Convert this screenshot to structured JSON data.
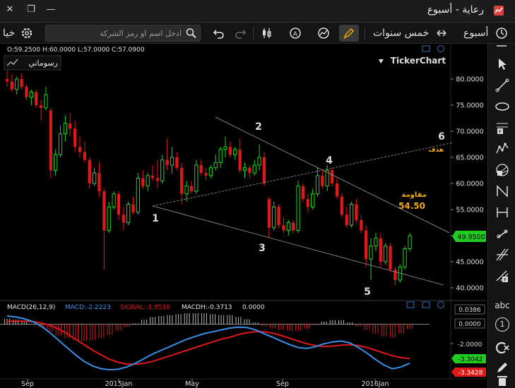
{
  "window": {
    "title": "رعاية - أسبوع",
    "close_glyph": "✕",
    "restore_glyph": "❐",
    "minimize_glyph": "—"
  },
  "toolbar": {
    "period_label": "أسبوع",
    "range_label": "خمس سنوات",
    "search_placeholder": "ادخل اسم او رمز الشركة",
    "options_label": "خيا"
  },
  "price_info": "O:59.2500  H:60.0000  L:57.0000  C:57.0900",
  "drawings_label": "رسوماتي",
  "brand": "TickerChart",
  "annotations": {
    "wave_labels": [
      "1",
      "2",
      "3",
      "4",
      "5",
      "6"
    ],
    "target_label": "هدف",
    "resistance_label": "مقاومة",
    "resistance_value": "54.50"
  },
  "macd_legend": {
    "name": "MACD(26,12,9)",
    "macd": "MACD:-2.2223",
    "signal": "SIGNAL:-1.8510",
    "macdh": "MACDH:-0.3713",
    "zero": "0.0000"
  },
  "sidebar_tools": [
    "cursor-icon",
    "trendline-icon",
    "ellipse-icon",
    "fibonacci-icon",
    "elliott-wave-icon",
    "fibonacci-fan-icon",
    "zigzag-icon",
    "hline-icon",
    "ray-icon",
    "andrews-pitchfork-icon",
    "fibonacci-retracement-icon",
    "text-tool-icon",
    "numbered-tool-icon",
    "delete-drawings-icon",
    "pencil-icon",
    "trash-icon"
  ],
  "sidebar_text": {
    "abc": "abc",
    "one": "1"
  },
  "colors": {
    "up": "#1fd31f",
    "down": "#e01818",
    "macd": "#3a8ee6",
    "signal": "#e01818",
    "accent": "#f2a900",
    "current_price_bg": "#1fcc1f"
  },
  "chart_data": {
    "type": "candlestick",
    "x_tick_labels": [
      "Sep",
      "2015Jan",
      "May",
      "Sep",
      "2016Jan"
    ],
    "y_tick_labels": [
      "40.0000",
      "45.0000",
      "50.0000",
      "55.0000",
      "60.0000",
      "65.0000",
      "70.0000",
      "75.0000",
      "80.0000"
    ],
    "ylim": [
      38.0,
      82.0
    ],
    "current_price_label": "49.9500",
    "candles": [
      {
        "o": 80.0,
        "h": 81.5,
        "l": 78.5,
        "c": 79.5
      },
      {
        "o": 79.5,
        "h": 81.0,
        "l": 77.5,
        "c": 78.0
      },
      {
        "o": 78.0,
        "h": 80.5,
        "l": 77.0,
        "c": 80.0
      },
      {
        "o": 80.0,
        "h": 81.0,
        "l": 78.0,
        "c": 78.5
      },
      {
        "o": 78.5,
        "h": 79.0,
        "l": 76.0,
        "c": 76.5
      },
      {
        "o": 76.5,
        "h": 78.0,
        "l": 75.0,
        "c": 77.5
      },
      {
        "o": 77.5,
        "h": 78.0,
        "l": 74.5,
        "c": 75.0
      },
      {
        "o": 75.0,
        "h": 76.0,
        "l": 72.0,
        "c": 74.5
      },
      {
        "o": 74.5,
        "h": 78.5,
        "l": 74.0,
        "c": 77.0
      },
      {
        "o": 74.0,
        "h": 74.5,
        "l": 61.0,
        "c": 62.5
      },
      {
        "o": 62.5,
        "h": 66.5,
        "l": 61.5,
        "c": 65.5
      },
      {
        "o": 65.5,
        "h": 71.0,
        "l": 65.0,
        "c": 69.5
      },
      {
        "o": 69.5,
        "h": 73.0,
        "l": 68.0,
        "c": 71.5
      },
      {
        "o": 71.5,
        "h": 73.5,
        "l": 69.0,
        "c": 70.5
      },
      {
        "o": 70.5,
        "h": 72.0,
        "l": 66.0,
        "c": 67.0
      },
      {
        "o": 67.0,
        "h": 69.0,
        "l": 65.0,
        "c": 66.0
      },
      {
        "o": 66.0,
        "h": 68.0,
        "l": 64.0,
        "c": 64.5
      },
      {
        "o": 64.5,
        "h": 65.0,
        "l": 59.0,
        "c": 60.0
      },
      {
        "o": 60.0,
        "h": 63.0,
        "l": 59.5,
        "c": 62.0
      },
      {
        "o": 62.0,
        "h": 64.0,
        "l": 57.5,
        "c": 58.5
      },
      {
        "o": 58.5,
        "h": 59.0,
        "l": 43.5,
        "c": 51.0
      },
      {
        "o": 51.0,
        "h": 56.5,
        "l": 50.5,
        "c": 55.5
      },
      {
        "o": 55.5,
        "h": 58.5,
        "l": 55.0,
        "c": 58.0
      },
      {
        "o": 58.0,
        "h": 58.5,
        "l": 53.0,
        "c": 54.0
      },
      {
        "o": 54.0,
        "h": 55.5,
        "l": 51.0,
        "c": 52.5
      },
      {
        "o": 52.5,
        "h": 56.5,
        "l": 52.0,
        "c": 56.0
      },
      {
        "o": 56.0,
        "h": 57.5,
        "l": 54.0,
        "c": 54.5
      },
      {
        "o": 54.5,
        "h": 62.0,
        "l": 54.0,
        "c": 61.0
      },
      {
        "o": 61.0,
        "h": 62.5,
        "l": 59.0,
        "c": 59.5
      },
      {
        "o": 59.5,
        "h": 62.0,
        "l": 58.5,
        "c": 61.5
      },
      {
        "o": 61.5,
        "h": 63.5,
        "l": 60.5,
        "c": 61.0
      },
      {
        "o": 61.0,
        "h": 64.5,
        "l": 59.0,
        "c": 60.5
      },
      {
        "o": 60.5,
        "h": 65.5,
        "l": 60.0,
        "c": 64.5
      },
      {
        "o": 64.5,
        "h": 68.5,
        "l": 62.5,
        "c": 63.5
      },
      {
        "o": 63.5,
        "h": 67.0,
        "l": 62.0,
        "c": 65.0
      },
      {
        "o": 65.0,
        "h": 66.0,
        "l": 62.5,
        "c": 63.0
      },
      {
        "o": 63.0,
        "h": 64.0,
        "l": 56.0,
        "c": 58.0
      },
      {
        "o": 58.0,
        "h": 60.5,
        "l": 56.5,
        "c": 59.5
      },
      {
        "o": 59.5,
        "h": 60.5,
        "l": 58.0,
        "c": 58.5
      },
      {
        "o": 58.5,
        "h": 64.5,
        "l": 58.0,
        "c": 63.5
      },
      {
        "o": 63.5,
        "h": 64.5,
        "l": 61.5,
        "c": 62.0
      },
      {
        "o": 62.0,
        "h": 63.0,
        "l": 60.5,
        "c": 61.5
      },
      {
        "o": 61.5,
        "h": 63.5,
        "l": 61.0,
        "c": 63.0
      },
      {
        "o": 63.0,
        "h": 65.5,
        "l": 62.5,
        "c": 64.0
      },
      {
        "o": 64.0,
        "h": 67.0,
        "l": 63.0,
        "c": 66.5
      },
      {
        "o": 66.5,
        "h": 69.0,
        "l": 65.0,
        "c": 67.0
      },
      {
        "o": 67.0,
        "h": 68.0,
        "l": 65.0,
        "c": 65.5
      },
      {
        "o": 65.5,
        "h": 67.0,
        "l": 64.5,
        "c": 66.5
      },
      {
        "o": 66.5,
        "h": 68.5,
        "l": 62.0,
        "c": 62.5
      },
      {
        "o": 62.5,
        "h": 64.0,
        "l": 61.0,
        "c": 63.0
      },
      {
        "o": 63.0,
        "h": 63.5,
        "l": 61.0,
        "c": 62.0
      },
      {
        "o": 62.0,
        "h": 64.5,
        "l": 61.5,
        "c": 63.5
      },
      {
        "o": 63.5,
        "h": 67.5,
        "l": 62.5,
        "c": 65.0
      },
      {
        "o": 65.0,
        "h": 66.0,
        "l": 59.5,
        "c": 60.0
      },
      {
        "o": 57.0,
        "h": 57.5,
        "l": 49.5,
        "c": 51.5
      },
      {
        "o": 51.5,
        "h": 56.5,
        "l": 51.0,
        "c": 55.5
      },
      {
        "o": 55.5,
        "h": 56.0,
        "l": 51.5,
        "c": 52.0
      },
      {
        "o": 52.0,
        "h": 53.5,
        "l": 50.5,
        "c": 51.0
      },
      {
        "o": 51.0,
        "h": 53.0,
        "l": 50.0,
        "c": 52.5
      },
      {
        "o": 52.5,
        "h": 53.0,
        "l": 50.5,
        "c": 51.0
      },
      {
        "o": 51.0,
        "h": 60.5,
        "l": 50.5,
        "c": 59.5
      },
      {
        "o": 59.5,
        "h": 60.0,
        "l": 56.5,
        "c": 57.0
      },
      {
        "o": 57.0,
        "h": 58.0,
        "l": 54.5,
        "c": 55.5
      },
      {
        "o": 55.5,
        "h": 59.0,
        "l": 55.0,
        "c": 58.0
      },
      {
        "o": 58.0,
        "h": 63.0,
        "l": 57.5,
        "c": 61.5
      },
      {
        "o": 61.5,
        "h": 62.5,
        "l": 59.0,
        "c": 59.5
      },
      {
        "o": 59.5,
        "h": 63.5,
        "l": 58.5,
        "c": 62.5
      },
      {
        "o": 62.5,
        "h": 63.0,
        "l": 59.5,
        "c": 60.0
      },
      {
        "o": 60.0,
        "h": 61.0,
        "l": 57.0,
        "c": 57.5
      },
      {
        "o": 57.5,
        "h": 58.0,
        "l": 53.5,
        "c": 54.0
      },
      {
        "o": 54.0,
        "h": 55.5,
        "l": 51.5,
        "c": 52.0
      },
      {
        "o": 52.0,
        "h": 56.5,
        "l": 51.5,
        "c": 56.0
      },
      {
        "o": 56.0,
        "h": 57.0,
        "l": 52.5,
        "c": 53.0
      },
      {
        "o": 53.0,
        "h": 54.0,
        "l": 50.5,
        "c": 51.0
      },
      {
        "o": 51.0,
        "h": 52.0,
        "l": 44.0,
        "c": 45.5
      },
      {
        "o": 45.5,
        "h": 49.5,
        "l": 41.5,
        "c": 48.0
      },
      {
        "o": 48.0,
        "h": 50.5,
        "l": 47.0,
        "c": 49.5
      },
      {
        "o": 49.5,
        "h": 50.5,
        "l": 44.0,
        "c": 45.0
      },
      {
        "o": 45.0,
        "h": 48.5,
        "l": 44.5,
        "c": 48.0
      },
      {
        "o": 48.0,
        "h": 48.5,
        "l": 43.0,
        "c": 43.5
      },
      {
        "o": 43.5,
        "h": 44.0,
        "l": 40.5,
        "c": 41.5
      },
      {
        "o": 41.5,
        "h": 44.5,
        "l": 41.0,
        "c": 44.0
      },
      {
        "o": 44.0,
        "h": 48.0,
        "l": 43.5,
        "c": 47.5
      },
      {
        "o": 47.5,
        "h": 50.5,
        "l": 47.0,
        "c": 50.0
      }
    ]
  },
  "macd_chart": {
    "right_labels": [
      "0.0386",
      "0.0000",
      "-2.0000"
    ],
    "macd_value_label": "-3.3042",
    "signal_value_label": "-3.3428",
    "ylim": [
      -5.2,
      1.2
    ],
    "macd_line": [
      0.9,
      0.8,
      0.6,
      0.3,
      -0.2,
      -0.9,
      -1.7,
      -2.5,
      -3.3,
      -4.0,
      -4.5,
      -4.8,
      -4.9,
      -4.85,
      -4.6,
      -4.2,
      -3.7,
      -3.2,
      -2.8,
      -2.4,
      -2.0,
      -1.6,
      -1.3,
      -1.0,
      -0.8,
      -0.6,
      -0.4,
      -0.3,
      -0.35,
      -0.6,
      -1.0,
      -1.4,
      -1.8,
      -2.2,
      -2.5,
      -2.6,
      -2.4,
      -2.1,
      -1.9,
      -1.8,
      -2.0,
      -2.5,
      -3.1,
      -3.8,
      -4.4,
      -4.8,
      -4.6,
      -4.2
    ],
    "signal_line": [
      0.3,
      0.35,
      0.35,
      0.3,
      0.15,
      -0.1,
      -0.5,
      -1.0,
      -1.6,
      -2.2,
      -2.8,
      -3.3,
      -3.8,
      -4.1,
      -4.3,
      -4.3,
      -4.2,
      -4.0,
      -3.7,
      -3.4,
      -3.1,
      -2.8,
      -2.5,
      -2.2,
      -1.9,
      -1.6,
      -1.4,
      -1.1,
      -0.9,
      -0.8,
      -0.8,
      -0.95,
      -1.2,
      -1.5,
      -1.8,
      -2.1,
      -2.3,
      -2.4,
      -2.35,
      -2.25,
      -2.2,
      -2.3,
      -2.5,
      -2.8,
      -3.1,
      -3.4,
      -3.6,
      -3.7
    ],
    "histogram": [
      0.6,
      0.5,
      0.3,
      0.05,
      -0.35,
      -0.8,
      -1.2,
      -1.5,
      -1.7,
      -1.8,
      -1.7,
      -1.5,
      -1.1,
      -0.7,
      -0.3,
      0.1,
      0.5,
      0.8,
      0.9,
      1.0,
      1.1,
      1.2,
      1.2,
      1.2,
      1.1,
      1.0,
      1.0,
      0.8,
      0.55,
      0.2,
      -0.2,
      -0.45,
      -0.6,
      -0.7,
      -0.7,
      -0.5,
      -0.1,
      0.3,
      0.45,
      0.45,
      0.2,
      -0.2,
      -0.6,
      -1.0,
      -1.3,
      -1.4,
      -1.0,
      -0.5
    ]
  }
}
